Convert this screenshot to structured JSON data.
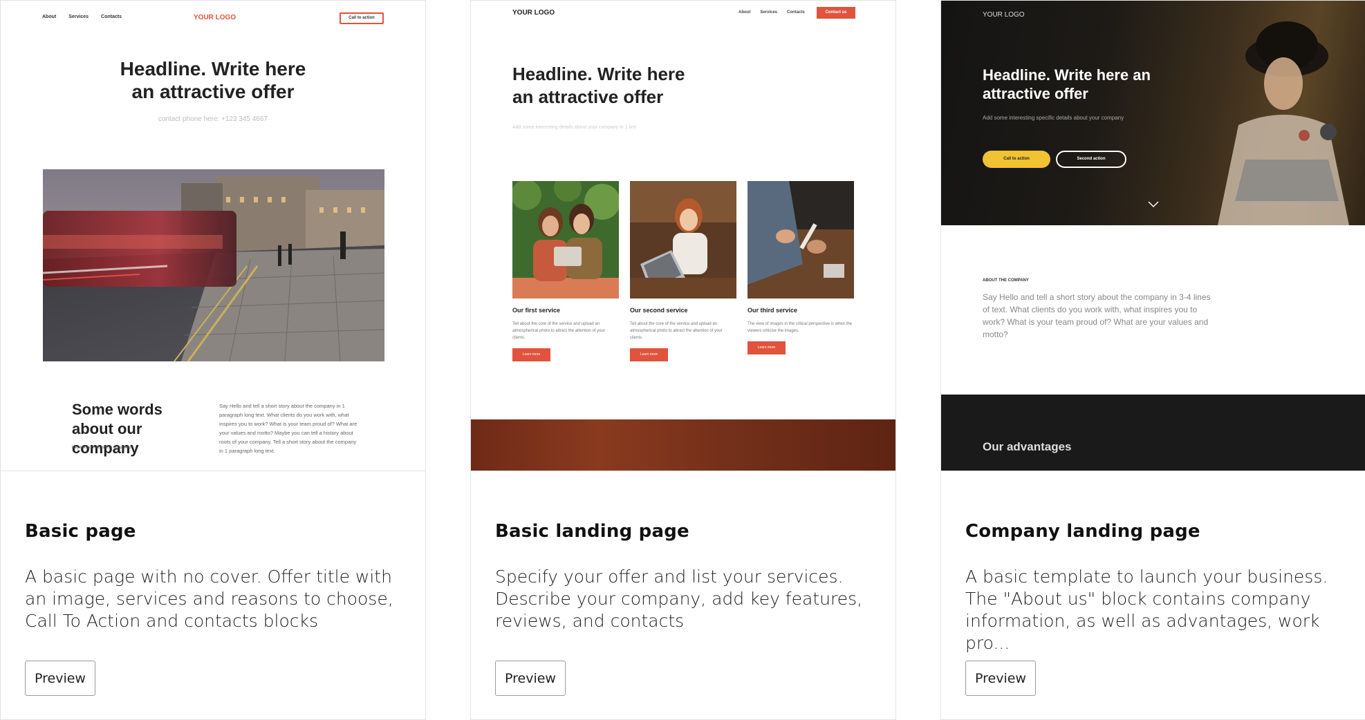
{
  "cards": [
    {
      "title": "Basic page",
      "description": "A basic page with no cover. Offer title with an image, services and reasons to choose, Call To Action and contacts blocks",
      "button": "Preview",
      "thumb": {
        "nav": [
          "About",
          "Services",
          "Contacts"
        ],
        "logo": "YOUR LOGO",
        "cta": "Call to action",
        "headline": "Headline. Write here an attractive offer",
        "phone": "contact phone here: +123 345 4667",
        "section_title": "Some words about our company",
        "keywords": "Keywords of business occupation",
        "paragraph": "Say Hello and tell a short story about the company in 1 paragraph long text. What clients do you work with, what inspires you to work? What is your team proud of? What are your values and motto? Maybe you can tell a history about roots of your company. Tell a short story about the company in 1 paragraph long text."
      }
    },
    {
      "title": "Basic landing page",
      "description": "Specify your offer and list your services. Describe your company, add key features, reviews, and contacts",
      "button": "Preview",
      "thumb": {
        "logo": "YOUR LOGO",
        "nav": [
          "About",
          "Services",
          "Contacts"
        ],
        "contact_btn": "Contact us",
        "headline": "Headline. Write here an attractive offer",
        "subtitle": "Add some interesting details about your company in 1 line",
        "services": [
          {
            "title": "Our first service",
            "desc": "Tell about the core of the service and upload an atmospherical photo to attract the attention of your clients.",
            "button": "Learn more"
          },
          {
            "title": "Our second service",
            "desc": "Tell about the core of the service and upload an atmospherical photo to attract the attention of your clients.",
            "button": "Learn more"
          },
          {
            "title": "Our third service",
            "desc": "The view of images in the critical perspective is when the viewers criticise the images.",
            "button": "Learn more"
          }
        ]
      }
    },
    {
      "title": "Company landing page",
      "description": "A basic template to launch your business. The \"About us\" block contains company information, as well as advantages, work pro...",
      "button": "Preview",
      "thumb": {
        "logo": "YOUR LOGO",
        "headline": "Headline. Write here an attractive offer",
        "subtitle": "Add some interesting specific details about your company",
        "btn_primary": "Call to action",
        "btn_secondary": "Second action",
        "about_label": "ABOUT THE COMPANY",
        "about_text": "Say Hello and tell a short story about the company in 3-4 lines of text. What clients do you work with, what inspires you to work? What is your team proud of? What are your values and motto?",
        "advantages": "Our advantages"
      }
    }
  ],
  "colors": {
    "accent": "#e0533c",
    "yellow": "#f1c232",
    "dark": "#1a1a1a"
  }
}
